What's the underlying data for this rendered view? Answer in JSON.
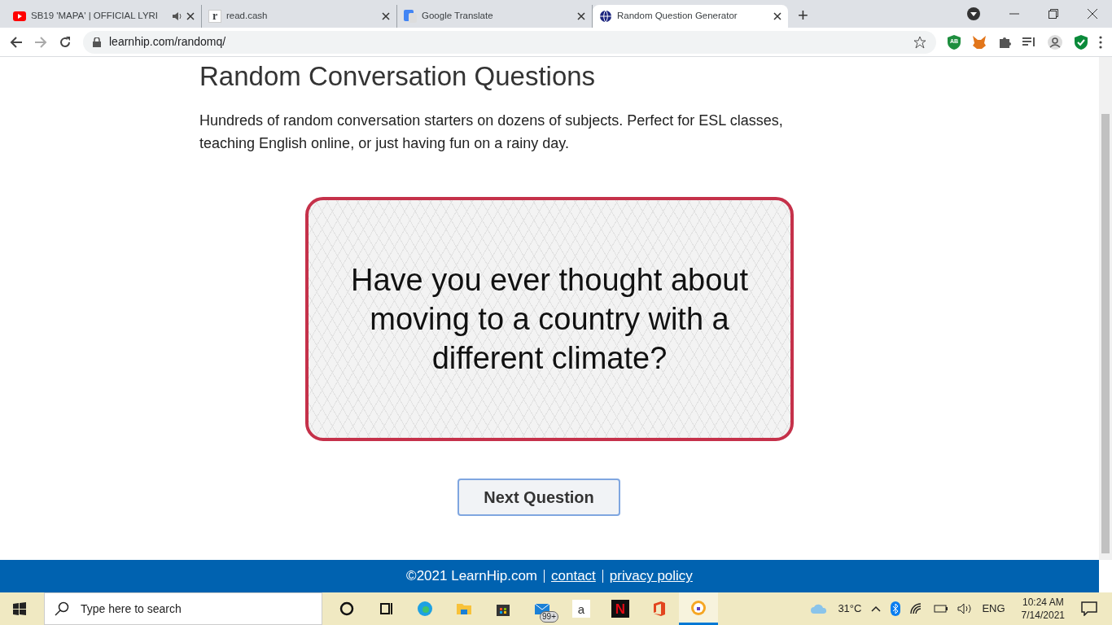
{
  "browser": {
    "tabs": [
      {
        "kind": "video",
        "title": "SB19 'MAPA' | OFFICIAL LYRI",
        "audio": true,
        "selected": false
      },
      {
        "kind": "letter",
        "icon_text": "r",
        "title": "read.cash",
        "audio": false,
        "selected": false
      },
      {
        "kind": "translate",
        "title": "Google Translate",
        "audio": false,
        "selected": false
      },
      {
        "kind": "globe",
        "title": "Random Question Generator",
        "audio": false,
        "selected": true
      }
    ],
    "new_tab": "+",
    "url": "learnhip.com/randomq/",
    "extension_badge": "AB"
  },
  "page": {
    "heading": "Random Conversation Questions",
    "intro": "Hundreds of random conversation starters on dozens of subjects. Perfect for ESL classes, teaching English online, or just having fun on a rainy day.",
    "question": "Have you ever thought about moving to a country with a different climate?",
    "button": "Next Question"
  },
  "footer": {
    "copyright": "©2021 LearnHip.com",
    "links": [
      "contact",
      "privacy policy"
    ]
  },
  "taskbar": {
    "search_placeholder": "Type here to search",
    "apps": [
      {
        "kind": "cortana",
        "selected": false
      },
      {
        "kind": "taskview",
        "selected": false
      },
      {
        "kind": "edge",
        "selected": false
      },
      {
        "kind": "folder",
        "selected": false
      },
      {
        "kind": "store",
        "selected": false
      },
      {
        "kind": "mail",
        "badge": "99+",
        "selected": false
      },
      {
        "kind": "amazon",
        "icon_text": "a",
        "selected": false
      },
      {
        "kind": "netflix",
        "icon_text": "N",
        "selected": false
      },
      {
        "kind": "office",
        "selected": false
      },
      {
        "kind": "vpn",
        "selected": true
      }
    ],
    "weather": "31°C",
    "language": "ENG",
    "time": "10:24 AM",
    "date": "7/14/2021"
  }
}
